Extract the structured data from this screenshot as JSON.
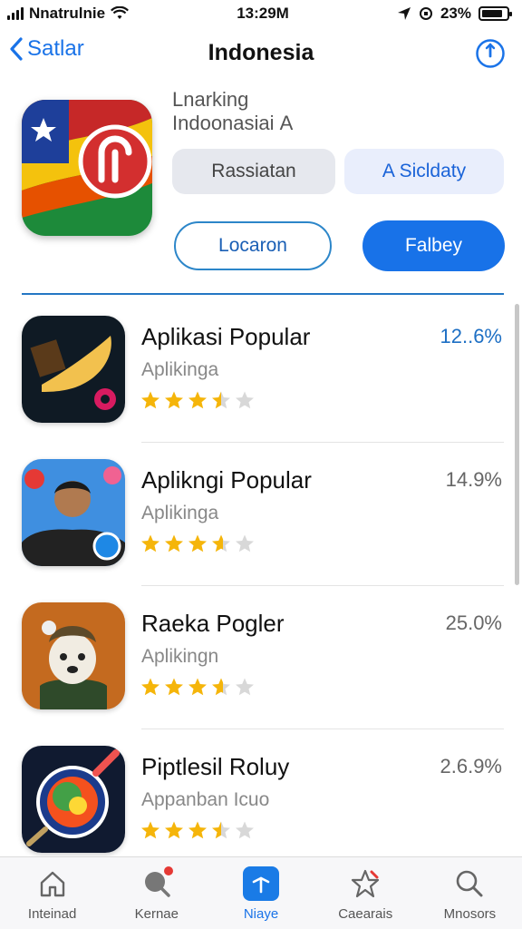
{
  "status_bar": {
    "carrier": "Nnatrulnie",
    "time": "13:29M",
    "battery": "23%",
    "battery_level": 0.85
  },
  "nav": {
    "back_label": "Satlar",
    "title": "Indonesia"
  },
  "header": {
    "line1": "Lnarking",
    "line2": "Indoonasiai Α",
    "btn_grey": "Rassiatan",
    "btn_light": "A Sicldaty",
    "btn_outline": "Locaron",
    "btn_solid": "Falbey"
  },
  "apps": [
    {
      "title": "Aplikasi Popular",
      "subtitle": "Aplikinga",
      "percent": "12..6%",
      "rating": 3.5,
      "percent_highlight": true,
      "icon": "horn-icon"
    },
    {
      "title": "Aplikngi Popular",
      "subtitle": "Aplikinga",
      "percent": "14.9%",
      "rating": 3.6,
      "percent_highlight": false,
      "icon": "person-icon"
    },
    {
      "title": "Raeka Pogler",
      "subtitle": "Aplikingn",
      "percent": "25.0%",
      "rating": 3.6,
      "percent_highlight": false,
      "icon": "dog-icon"
    },
    {
      "title": "Piptlesil Roluy",
      "subtitle": "Appanban  Icuo",
      "percent": "2.6.9%",
      "rating": 3.5,
      "percent_highlight": false,
      "icon": "globe-icon"
    }
  ],
  "tabs": [
    {
      "label": "Inteinad",
      "icon": "home-icon",
      "active": false
    },
    {
      "label": "Kernae",
      "icon": "search-dot-icon",
      "active": false
    },
    {
      "label": "Niaye",
      "icon": "arrow-up-icon",
      "active": true
    },
    {
      "label": "Caearais",
      "icon": "star-icon",
      "active": false
    },
    {
      "label": "Mnosors",
      "icon": "search-icon",
      "active": false
    }
  ],
  "colors": {
    "accent": "#1872e8",
    "star_full": "#f5b50a",
    "star_empty": "#d8d8d8"
  }
}
